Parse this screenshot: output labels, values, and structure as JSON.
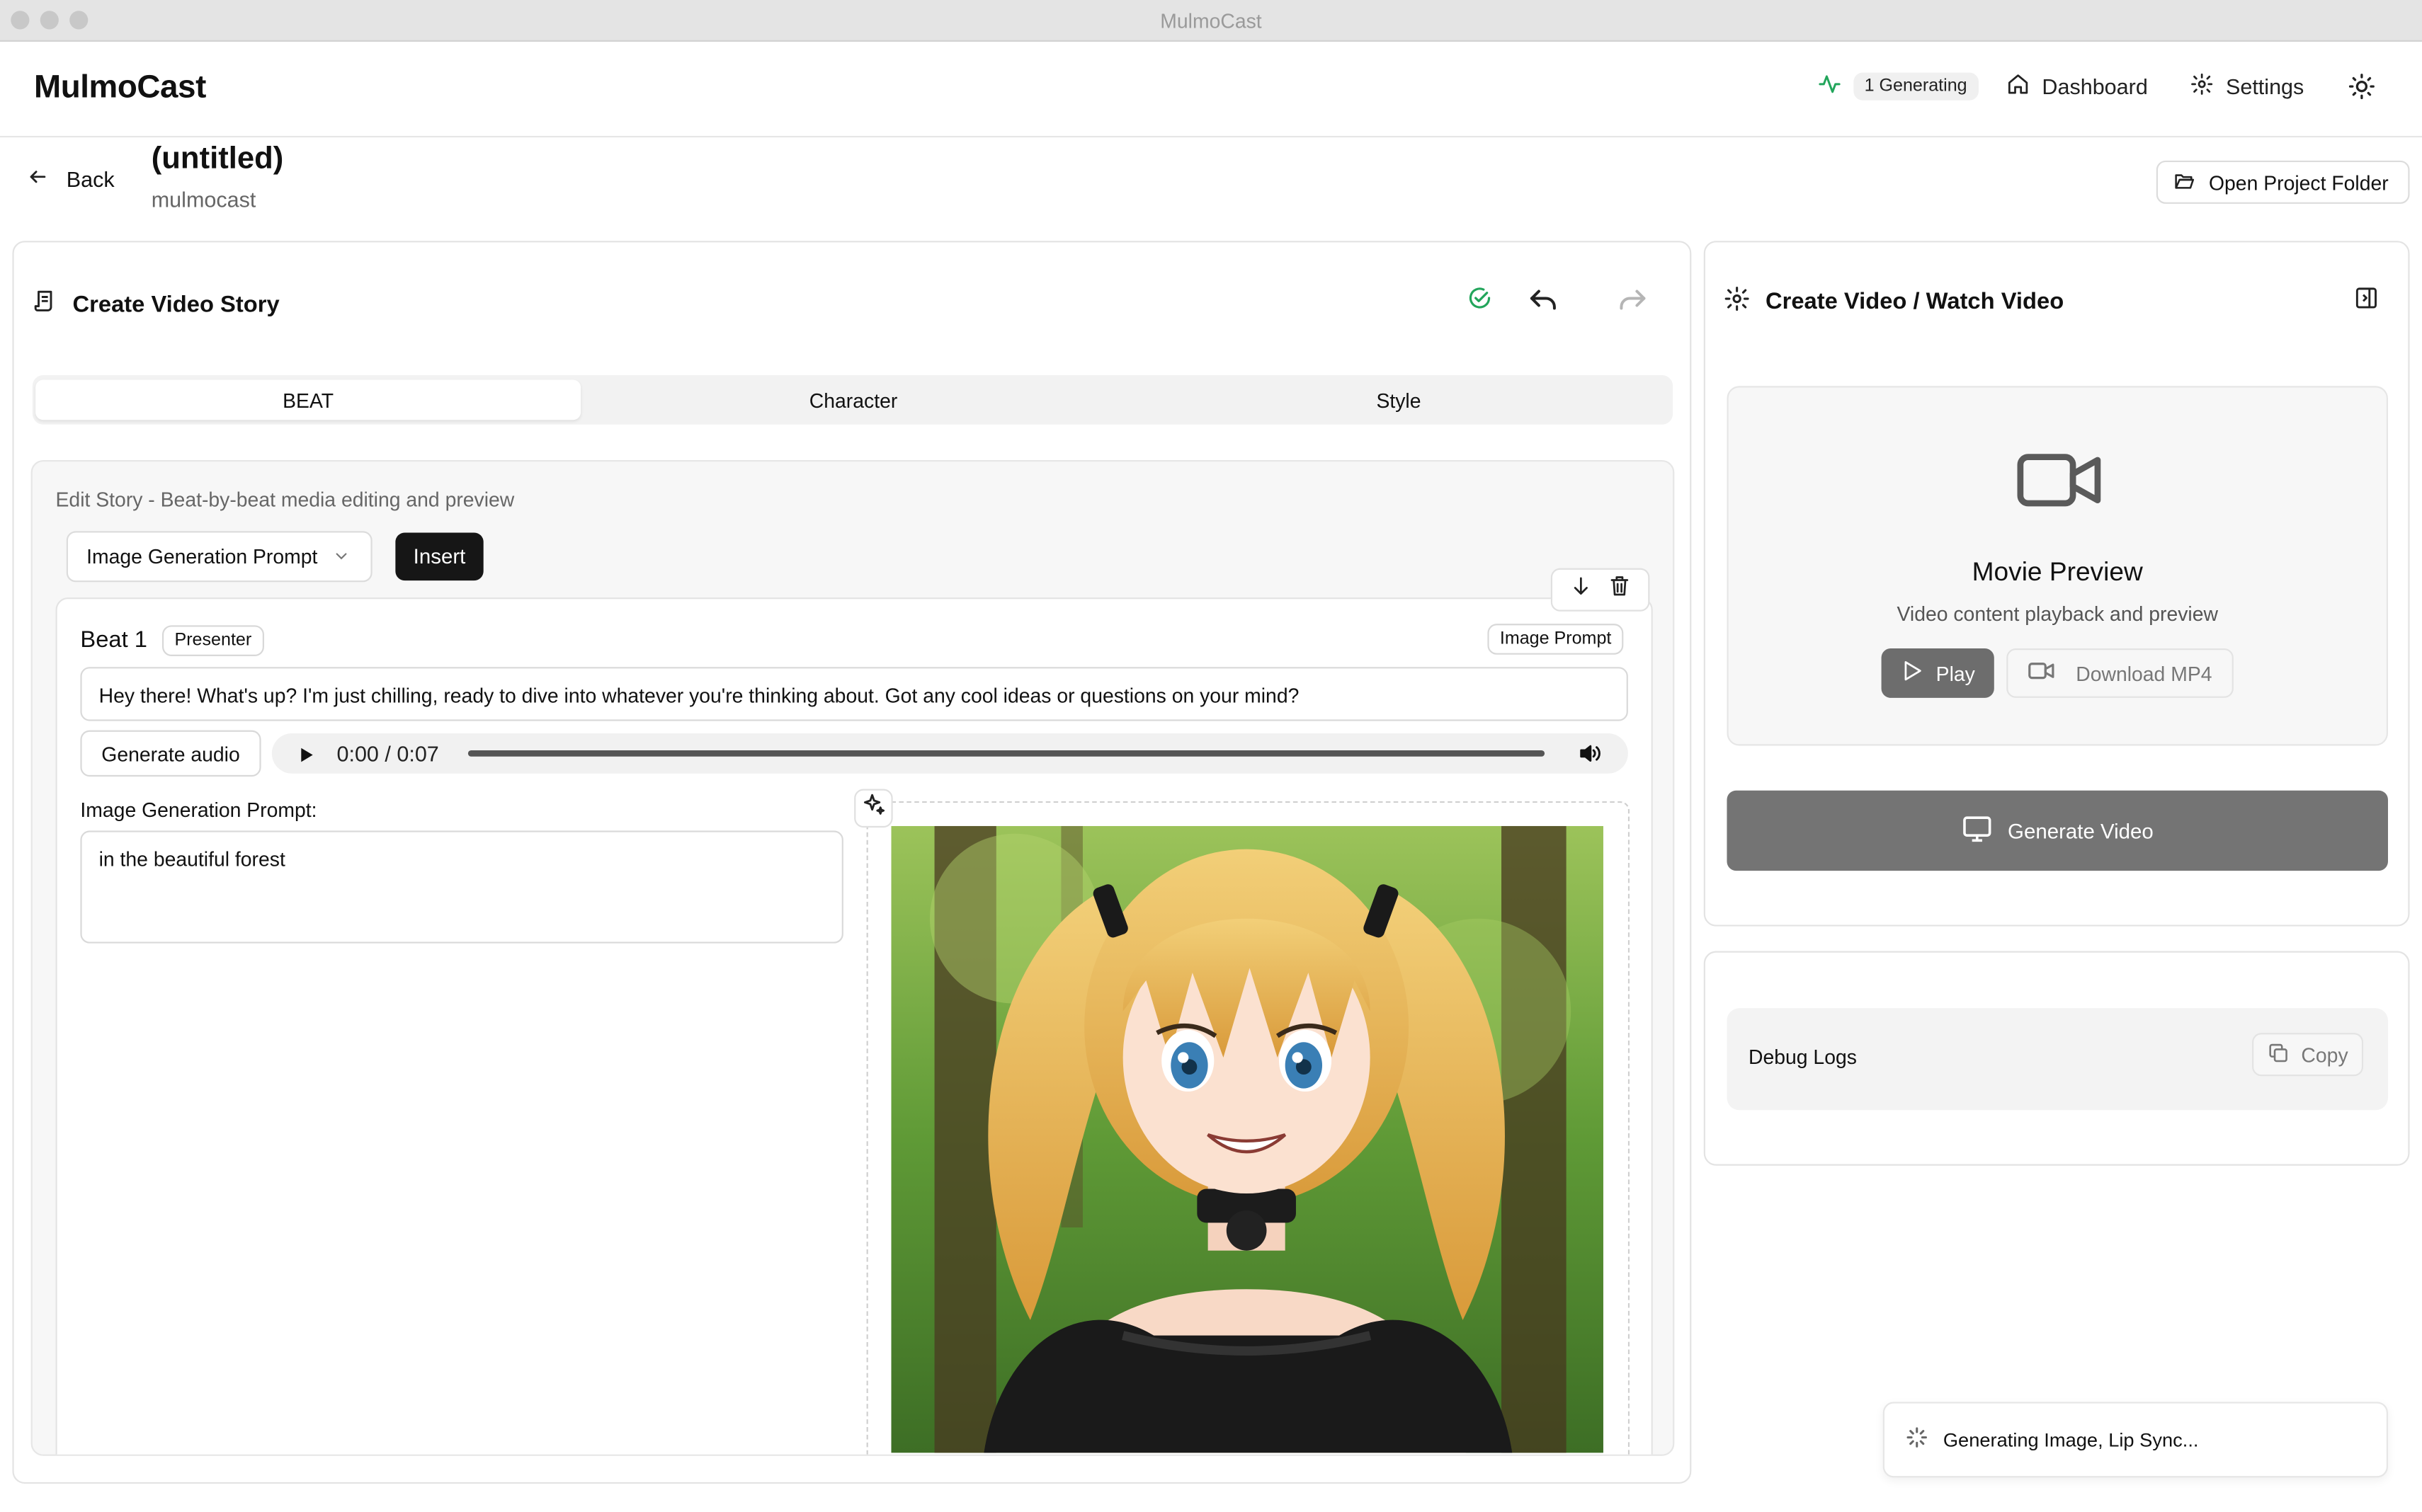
{
  "window": {
    "title": "MulmoCast"
  },
  "header": {
    "brand": "MulmoCast",
    "status_badge": "1 Generating",
    "dashboard_label": "Dashboard",
    "settings_label": "Settings"
  },
  "project": {
    "back_label": "Back",
    "title": "(untitled)",
    "subtitle": "mulmocast",
    "open_folder_label": "Open Project Folder"
  },
  "editor": {
    "heading": "Create Video Story",
    "tabs": [
      {
        "label": "BEAT",
        "active": true
      },
      {
        "label": "Character",
        "active": false
      },
      {
        "label": "Style",
        "active": false
      }
    ],
    "description": "Edit Story - Beat-by-beat media editing and preview",
    "beat_type_select": "Image Generation Prompt",
    "insert_label": "Insert",
    "beat": {
      "title": "Beat 1",
      "speaker": "Presenter",
      "type_badge": "Image Prompt",
      "text": "Hey there! What's up? I'm just chilling, ready to dive into whatever you're thinking about. Got any cool ideas or questions on your mind?",
      "generate_audio_label": "Generate audio",
      "audio_time": "0:00 / 0:07",
      "prompt_label": "Image Generation Prompt:",
      "prompt_value": "in the beautiful forest"
    }
  },
  "preview": {
    "heading": "Create Video / Watch Video",
    "title": "Movie Preview",
    "subtitle": "Video content playback and preview",
    "play_label": "Play",
    "download_label": "Download MP4",
    "generate_label": "Generate Video"
  },
  "debug": {
    "label": "Debug Logs",
    "copy_label": "Copy"
  },
  "toast": {
    "message": "Generating Image, Lip Sync..."
  },
  "colors": {
    "accent_green": "#22a55b",
    "primary_dark": "#161616",
    "disabled_gray": "#747474"
  }
}
